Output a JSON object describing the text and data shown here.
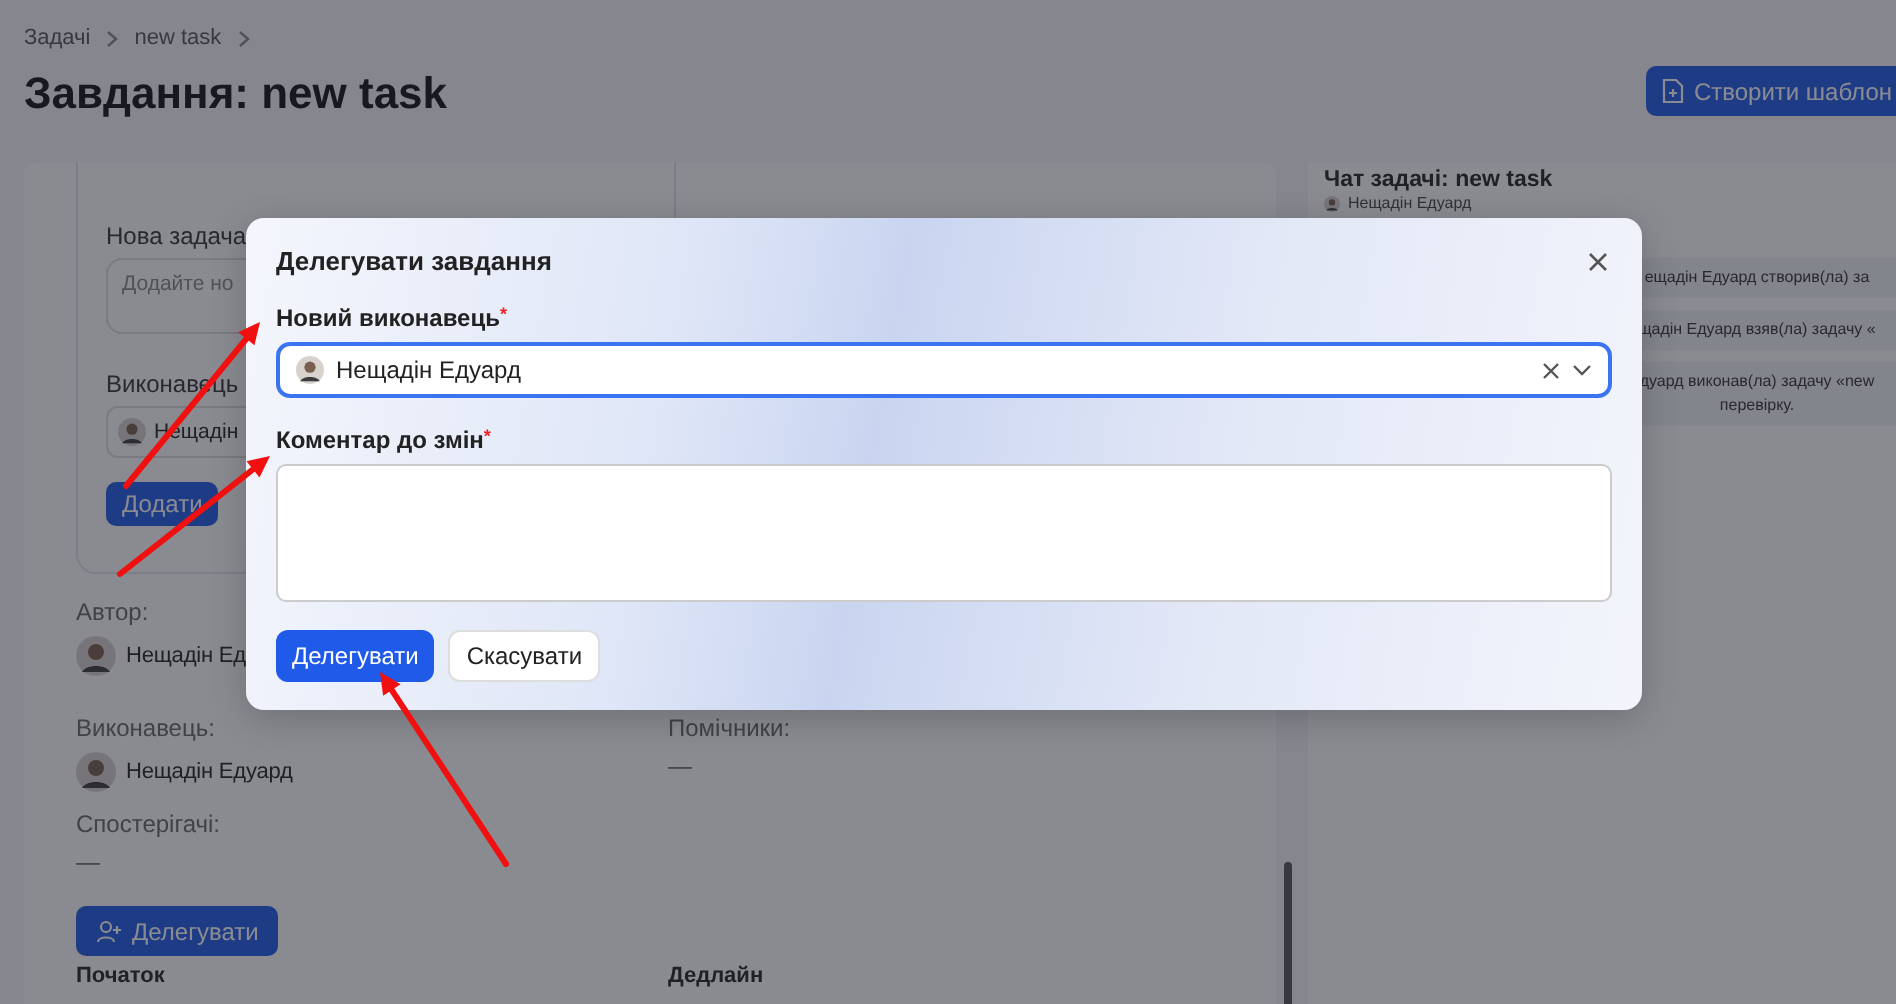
{
  "breadcrumbs": [
    {
      "label": "Задачі"
    },
    {
      "label": "new task"
    }
  ],
  "page_title": "Завдання: new task",
  "create_template_button": "Створити шаблон",
  "new_task_card": {
    "label": "Нова задача",
    "placeholder": "Додайте но",
    "assignee_label": "Виконавець",
    "assignee_value": "Нещадін",
    "add_button": "Додати"
  },
  "details": {
    "author_label": "Автор:",
    "author": "Нещадін Ед",
    "assignee_label": "Виконавець:",
    "assignee": "Нещадін Едуард",
    "helpers_label": "Помічники:",
    "helpers": "—",
    "watchers_label": "Спостерігачі:",
    "watchers": "—",
    "delegate_button": "Делегувати",
    "start_label": "Початок",
    "deadline_label": "Дедлайн"
  },
  "chat": {
    "title": "Чат задачі: new task",
    "author": "Нещадін Едуард",
    "messages": [
      {
        "lines": [
          "ещадін Едуард створив(ла) за"
        ]
      },
      {
        "lines": [
          "щадін Едуард взяв(ла) задачу «"
        ]
      },
      {
        "lines": [
          "дуард виконав(ла) задачу «new",
          "перевірку."
        ]
      }
    ]
  },
  "modal": {
    "title": "Делегувати завдання",
    "assignee_field": {
      "label": "Новий виконавець",
      "required_mark": "*",
      "value": "Нещадін Едуард",
      "focused": true
    },
    "comment_field": {
      "label": "Коментар до змін",
      "required_mark": "*"
    },
    "buttons": [
      {
        "label": "Делегувати",
        "kind": "primary"
      },
      {
        "label": "Скасувати",
        "kind": "secondary"
      }
    ]
  }
}
